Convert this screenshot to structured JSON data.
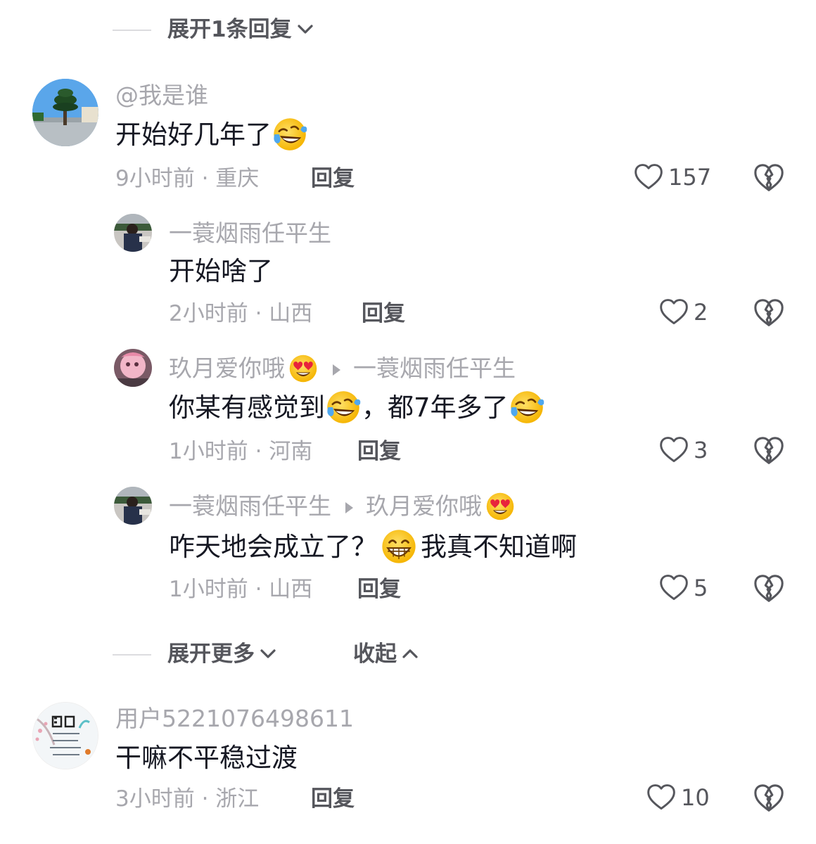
{
  "top_expand": {
    "label": "展开1条回复"
  },
  "comments": [
    {
      "username": "@我是谁",
      "text": "开始好几年了",
      "time_location": "9小时前 · 重庆",
      "reply_label": "回复",
      "likes": "157",
      "replies": [
        {
          "username": "一蓑烟雨任平生",
          "text": "开始啥了",
          "time_location": "2小时前 · 山西",
          "reply_label": "回复",
          "likes": "2"
        },
        {
          "username": "玖月爱你哦",
          "reply_to": "一蓑烟雨任平生",
          "text_part1": "你某有感觉到",
          "text_part2": "，都7年多了",
          "time_location": "1小时前 · 河南",
          "reply_label": "回复",
          "likes": "3"
        },
        {
          "username": "一蓑烟雨任平生",
          "reply_to": "玖月爱你哦",
          "text_part1": "咋天地会成立了？",
          "text_part2": "我真不知道啊",
          "time_location": "1小时前 · 山西",
          "reply_label": "回复",
          "likes": "5"
        }
      ],
      "expand_more_label": "展开更多",
      "collapse_label": "收起"
    },
    {
      "username": "用户5221076498611",
      "text": "干嘛不平稳过渡",
      "time_location": "3小时前 · 浙江",
      "reply_label": "回复",
      "likes": "10"
    }
  ],
  "icons": {
    "like": "heart-outline-icon",
    "dislike": "broken-heart-icon",
    "expand": "chevron-down-icon",
    "collapse": "chevron-up-icon",
    "reply_arrow": "triangle-right-icon",
    "emoji_laugh_cry": "rolling-laughing-emoji",
    "emoji_heart_eyes": "heart-eyes-emoji",
    "emoji_grin": "grinning-emoji"
  },
  "colors": {
    "primary_text": "#161823",
    "secondary_text": "#a7a7ad",
    "action_text": "#55565c",
    "divider": "#dcdcdf"
  }
}
